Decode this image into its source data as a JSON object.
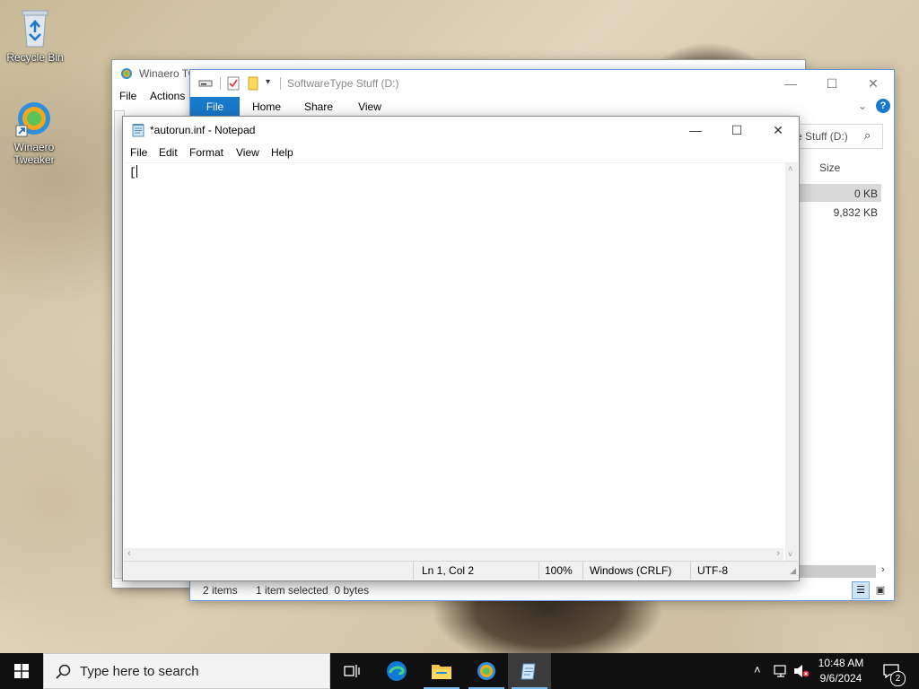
{
  "desktop": {
    "icons": [
      {
        "label": "Recycle Bin"
      },
      {
        "label": "Winaero Tweaker"
      }
    ]
  },
  "winaero_window": {
    "title": "Winaero Tw",
    "menu": [
      "File",
      "Actions"
    ]
  },
  "explorer": {
    "title": "SoftwareType Stuff (D:)",
    "ribbon_tabs": [
      "File",
      "Home",
      "Share",
      "View"
    ],
    "search_fragment": "e Stuff (D:)",
    "column_size": "Size",
    "rows": [
      {
        "size": "0 KB"
      },
      {
        "size": "9,832 KB"
      }
    ],
    "status_items": "2 items",
    "status_selected": "1 item selected  0 bytes"
  },
  "notepad": {
    "title": "*autorun.inf - Notepad",
    "menu": [
      "File",
      "Edit",
      "Format",
      "View",
      "Help"
    ],
    "content": "[",
    "status": {
      "position": "Ln 1, Col 2",
      "zoom": "100%",
      "line_ending": "Windows (CRLF)",
      "encoding": "UTF-8"
    }
  },
  "taskbar": {
    "search_placeholder": "Type here to search",
    "time": "10:48 AM",
    "date": "9/6/2024",
    "notification_count": "2"
  }
}
